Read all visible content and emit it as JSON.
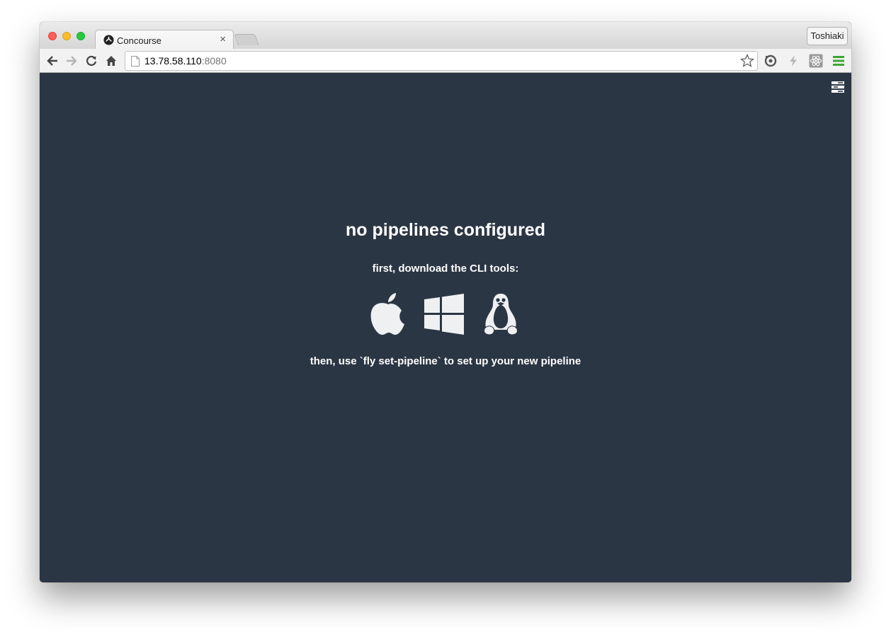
{
  "browser": {
    "tab": {
      "title": "Concourse",
      "close_glyph": "×",
      "favicon": "concourse-icon"
    },
    "profile_name": "Toshiaki",
    "address": {
      "host": "13.78.58.110",
      "port": ":8080"
    },
    "toolbar_icons": [
      "back-arrow-icon",
      "forward-arrow-icon",
      "reload-icon",
      "home-icon",
      "bookmark-star-icon",
      "sync-extension-icon",
      "lightning-extension-icon",
      "react-extension-icon",
      "menu-icon"
    ],
    "accent_color": "#3aa832"
  },
  "page": {
    "background": "#2b3644",
    "heading": "no pipelines configured",
    "cli_prompt": "first, download the CLI tools:",
    "downloads": [
      {
        "os": "apple",
        "icon": "apple-icon"
      },
      {
        "os": "windows",
        "icon": "windows-icon"
      },
      {
        "os": "linux",
        "icon": "linux-tux-icon"
      }
    ],
    "instruction": "then, use `fly set-pipeline` to set up your new pipeline"
  }
}
